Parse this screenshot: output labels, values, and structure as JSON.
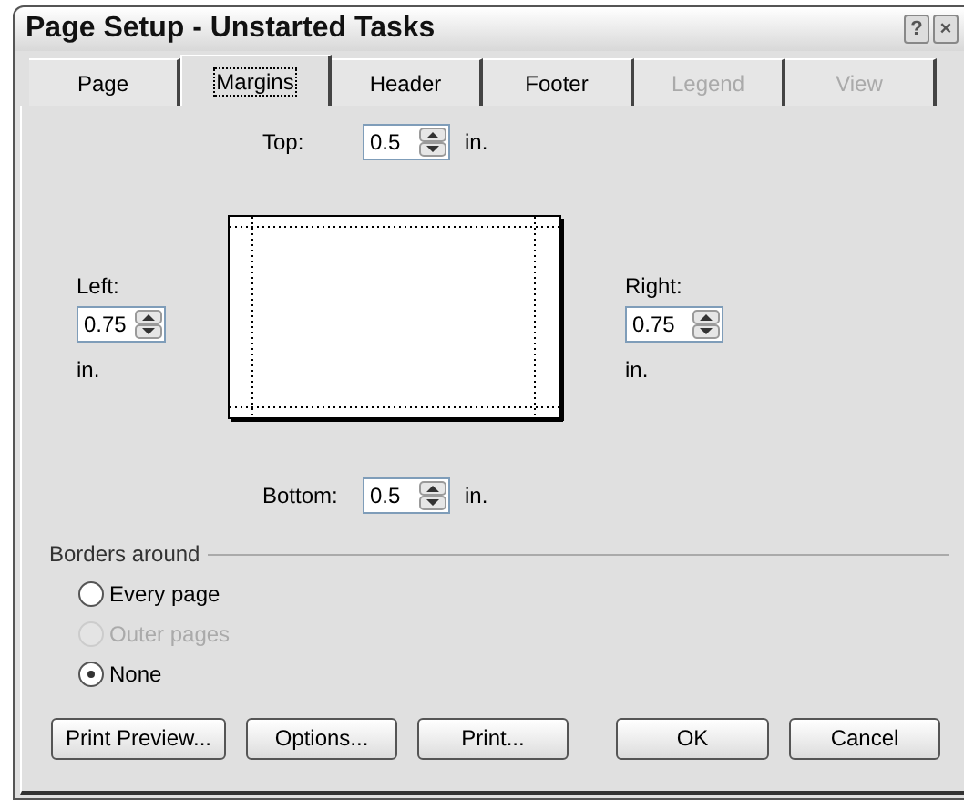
{
  "window": {
    "title": "Page Setup - Unstarted Tasks",
    "title_buttons": [
      "?",
      "×"
    ]
  },
  "tabs": [
    {
      "label": "Page",
      "selected": false,
      "disabled": false
    },
    {
      "label": "Margins",
      "selected": true,
      "disabled": false
    },
    {
      "label": "Header",
      "selected": false,
      "disabled": false
    },
    {
      "label": "Footer",
      "selected": false,
      "disabled": false
    },
    {
      "label": "Legend",
      "selected": false,
      "disabled": true
    },
    {
      "label": "View",
      "selected": false,
      "disabled": true
    }
  ],
  "margins": {
    "top": {
      "label": "Top:",
      "value": "0.5",
      "unit": "in."
    },
    "left": {
      "label": "Left:",
      "value": "0.75",
      "unit": "in."
    },
    "right": {
      "label": "Right:",
      "value": "0.75",
      "unit": "in."
    },
    "bottom": {
      "label": "Bottom:",
      "value": "0.5",
      "unit": "in."
    }
  },
  "borders_around": {
    "title": "Borders around",
    "options": [
      {
        "label": "Every page",
        "selected": false,
        "disabled": false
      },
      {
        "label": "Outer pages",
        "selected": false,
        "disabled": true
      },
      {
        "label": "None",
        "selected": true,
        "disabled": false
      }
    ]
  },
  "buttons": [
    "Print Preview...",
    "Options...",
    "Print...",
    "OK",
    "Cancel"
  ]
}
